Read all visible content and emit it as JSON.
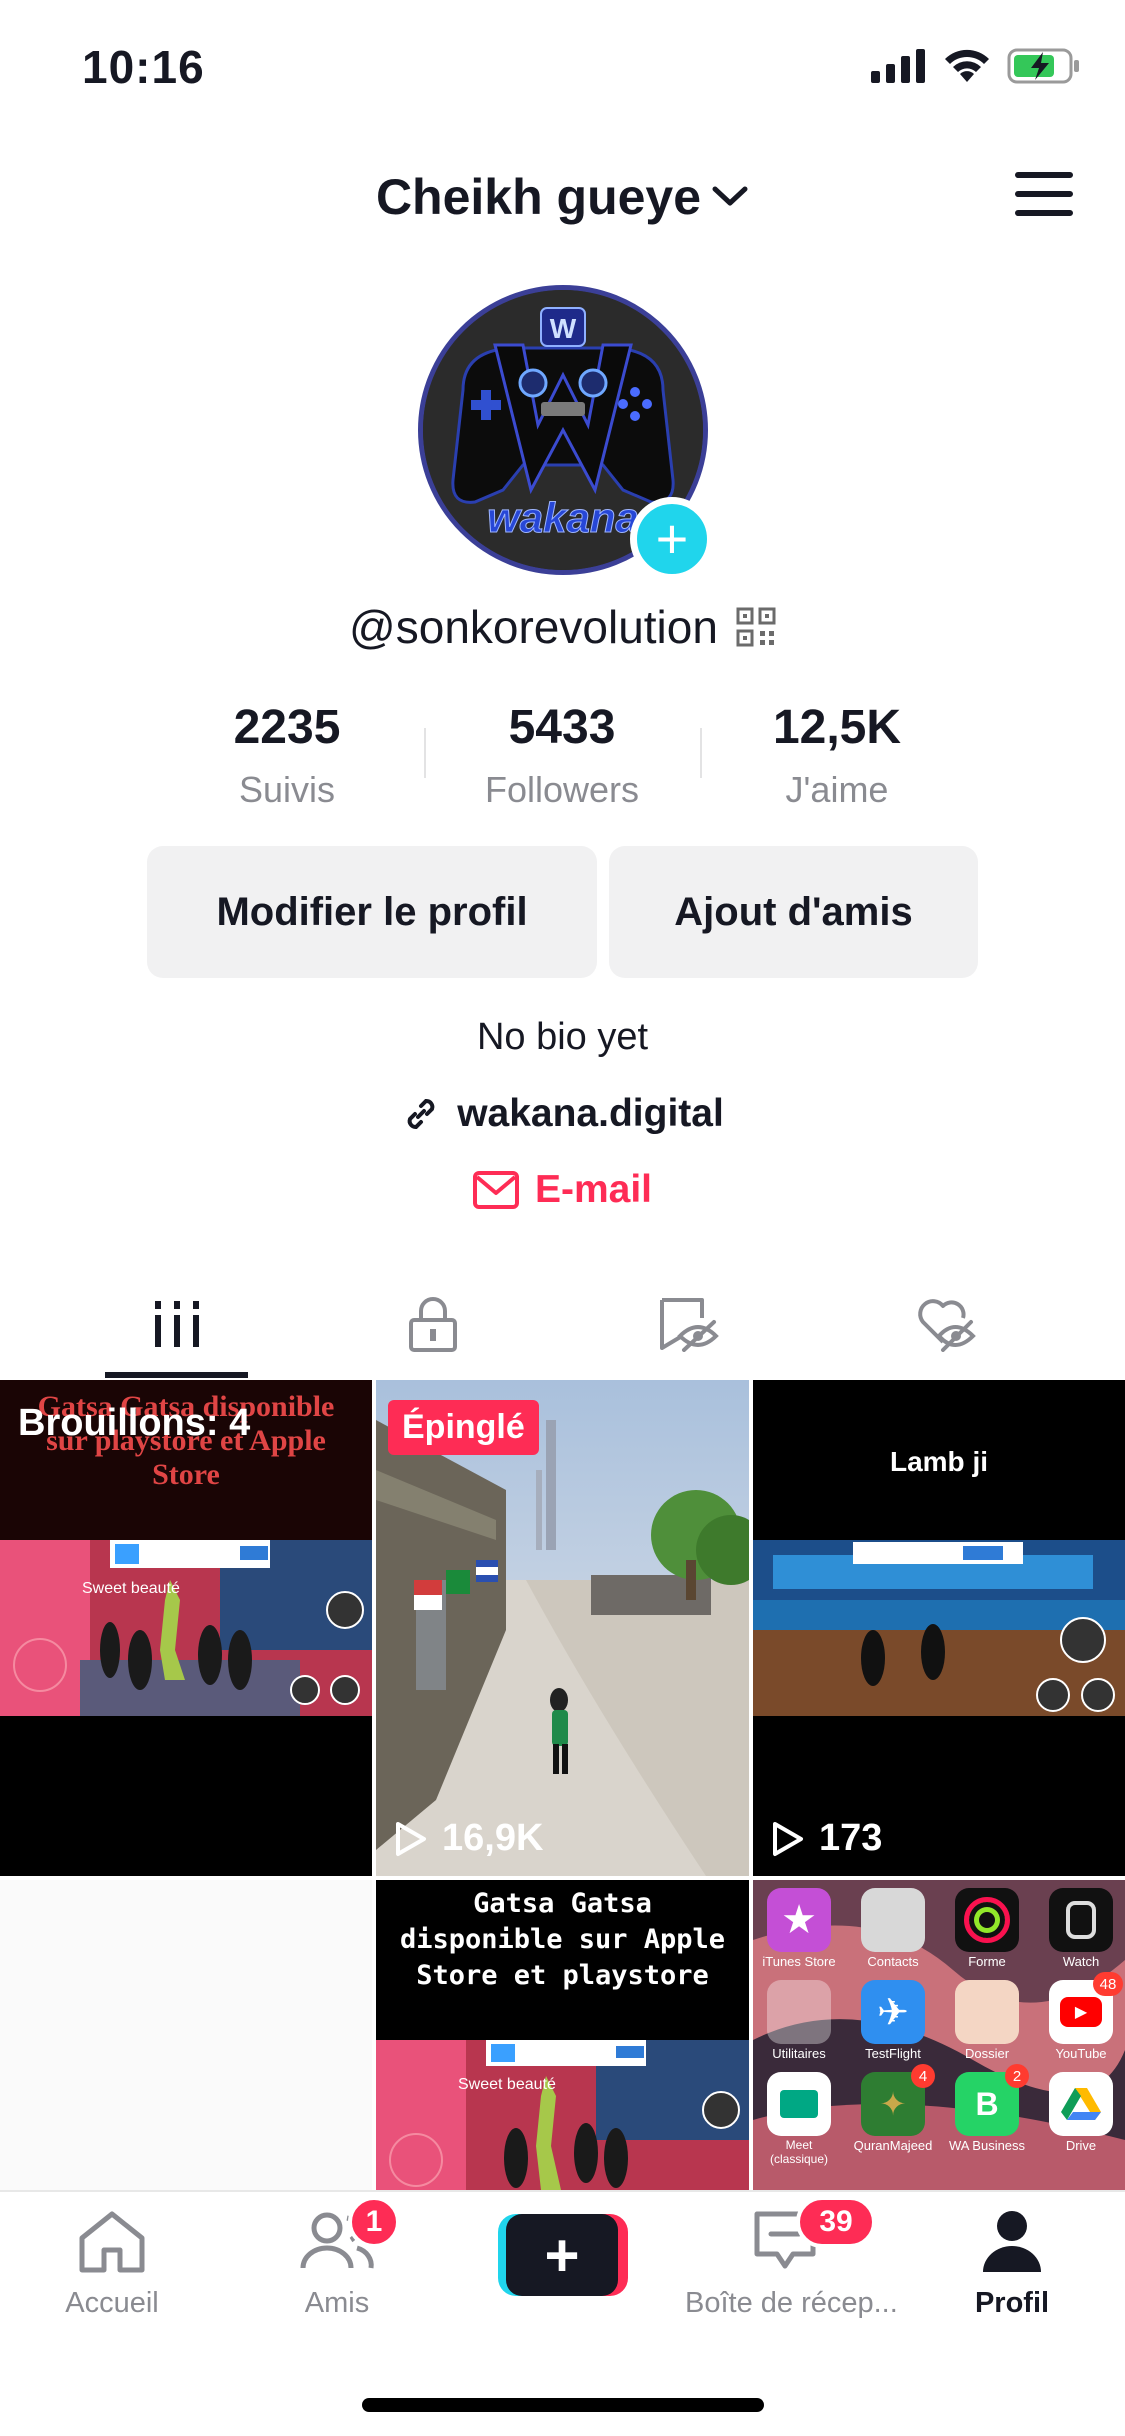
{
  "status_bar": {
    "time": "10:16"
  },
  "header": {
    "title": "Cheikh gueye"
  },
  "profile": {
    "avatar_text": "wakana",
    "handle": "@sonkorevolution",
    "stats": [
      {
        "value": "2235",
        "label": "Suivis"
      },
      {
        "value": "5433",
        "label": "Followers"
      },
      {
        "value": "12,5K",
        "label": "J'aime"
      }
    ],
    "edit_button": "Modifier le profil",
    "add_friends_button": "Ajout d'amis",
    "bio": "No bio yet",
    "link": "wakana.digital",
    "email": "E-mail"
  },
  "tabs": [
    "videos-icon",
    "lock-icon",
    "saved-icon",
    "liked-icon"
  ],
  "grid": {
    "drafts_label": "Brouillons: 4",
    "drafts_caption": "Gatsa Gatsa disponible sur playstore et Apple Store",
    "drafts_overlay": "Sweet beauté",
    "pinned_badge": "Épinglé",
    "pinned_views": "16,9K",
    "video3_caption": "Lamb ji",
    "video3_views": "173",
    "video5_caption": "Gatsa Gatsa disponible sur Apple Store et playstore",
    "video5_overlay": "Sweet beauté",
    "app_labels": [
      "iTunes Store",
      "Contacts",
      "Forme",
      "Watch",
      "Utilitaires",
      "TestFlight",
      "Dossier",
      "YouTube",
      "Meet (classique)",
      "QuranMajeed",
      "WA Business",
      "Drive"
    ],
    "app_badges": {
      "youtube": "48",
      "quran": "4",
      "wa": "2"
    }
  },
  "bottom_nav": {
    "home": "Accueil",
    "friends": "Amis",
    "friends_badge": "1",
    "inbox": "Boîte de récep...",
    "inbox_badge": "39",
    "profile": "Profil"
  },
  "colors": {
    "accent": "#fe2c55",
    "cyan": "#20d5ec",
    "text": "#161823",
    "muted": "#8a8b91"
  }
}
